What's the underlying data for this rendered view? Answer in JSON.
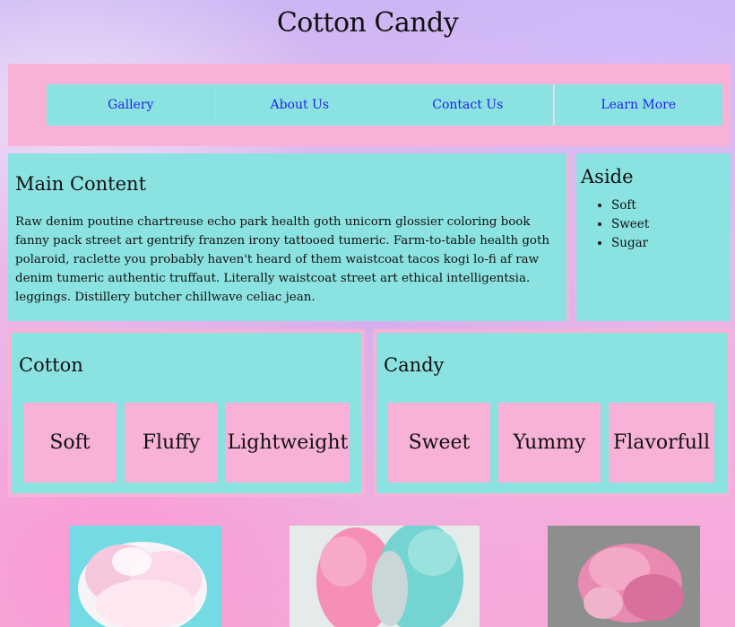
{
  "header": {
    "title": "Cotton Candy"
  },
  "nav": {
    "items": [
      {
        "label": "Gallery"
      },
      {
        "label": "About Us"
      },
      {
        "label": "Contact Us"
      },
      {
        "label": "Learn More"
      }
    ]
  },
  "main": {
    "heading": "Main Content",
    "body": "Raw denim poutine chartreuse echo park health goth unicorn glossier coloring book fanny pack street art gentrify franzen irony tattooed tumeric. Farm-to-table health goth polaroid, raclette you probably haven't heard of them waistcoat tacos kogi lo-fi af raw denim tumeric authentic truffaut. Literally waistcoat street art ethical intelligentsia. leggings. Distillery butcher chillwave celiac jean."
  },
  "aside": {
    "heading": "Aside",
    "items": [
      "Soft",
      "Sweet",
      "Sugar"
    ]
  },
  "cotton": {
    "heading": "Cotton",
    "boxes": [
      "Soft",
      "Fluffy",
      "Lightweight"
    ]
  },
  "candy": {
    "heading": "Candy",
    "boxes": [
      "Sweet",
      "Yummy",
      "Flavorfull"
    ]
  },
  "colors": {
    "pink": "#f8b2d7",
    "aqua": "#8be3e1",
    "link": "#2222ee"
  },
  "images": [
    "cotton-candy-photo",
    "cotton-candy-photo",
    "cotton-candy-photo"
  ]
}
